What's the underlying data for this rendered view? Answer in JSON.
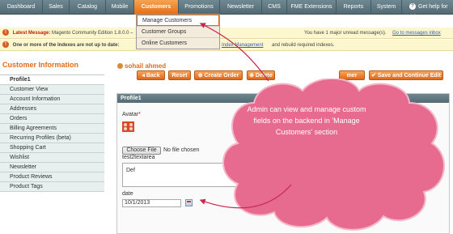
{
  "nav": {
    "items": [
      {
        "label": "Dashboard"
      },
      {
        "label": "Sales"
      },
      {
        "label": "Catalog"
      },
      {
        "label": "Mobile"
      },
      {
        "label": "Customers"
      },
      {
        "label": "Promotions"
      },
      {
        "label": "Newsletter"
      },
      {
        "label": "CMS"
      },
      {
        "label": "FME Extensions"
      },
      {
        "label": "Reports"
      },
      {
        "label": "System"
      }
    ],
    "active": "Customers",
    "help": "Get help for this page"
  },
  "dropdown": {
    "items": [
      "Manage Customers",
      "Customer Groups",
      "Online Customers"
    ]
  },
  "messages": {
    "latest_label": "Latest Message:",
    "latest_text": "Magento Community Edition 1.8.0.0 –",
    "unread_text": "You have 1 major unread message(s).",
    "unread_link": "Go to messages inbox",
    "index_text": "One or more of the Indexes are not up to date:",
    "index_link": "Index Management",
    "index_tail": "and rebuild required indexes."
  },
  "sidebar": {
    "title": "Customer Information",
    "items": [
      "Profile1",
      "Customer View",
      "Account Information",
      "Addresses",
      "Orders",
      "Billing Agreements",
      "Recurring Profiles (beta)",
      "Shopping Cart",
      "Wishlist",
      "Newsletter",
      "Product Reviews",
      "Product Tags"
    ],
    "active_index": 0
  },
  "main": {
    "customer_name": "sohail ahmed",
    "buttons": {
      "back": "Back",
      "reset": "Reset",
      "create_order": "Create Order",
      "delete": "Delete",
      "partial": "mer",
      "save_continue": "Save and Continue Edit"
    },
    "panel_title": "Profile1",
    "avatar_label": "Avatar",
    "choose_file": "Choose File",
    "no_file": "No file chosen",
    "textarea_label": "test2textarea",
    "textarea_value": "Def",
    "date_label": "date",
    "date_value": "10/1/2013"
  },
  "callout": {
    "text": "Admin can view and manage custom fields on the backend in 'Manage Customers' section",
    "color": "#e76b8f"
  }
}
